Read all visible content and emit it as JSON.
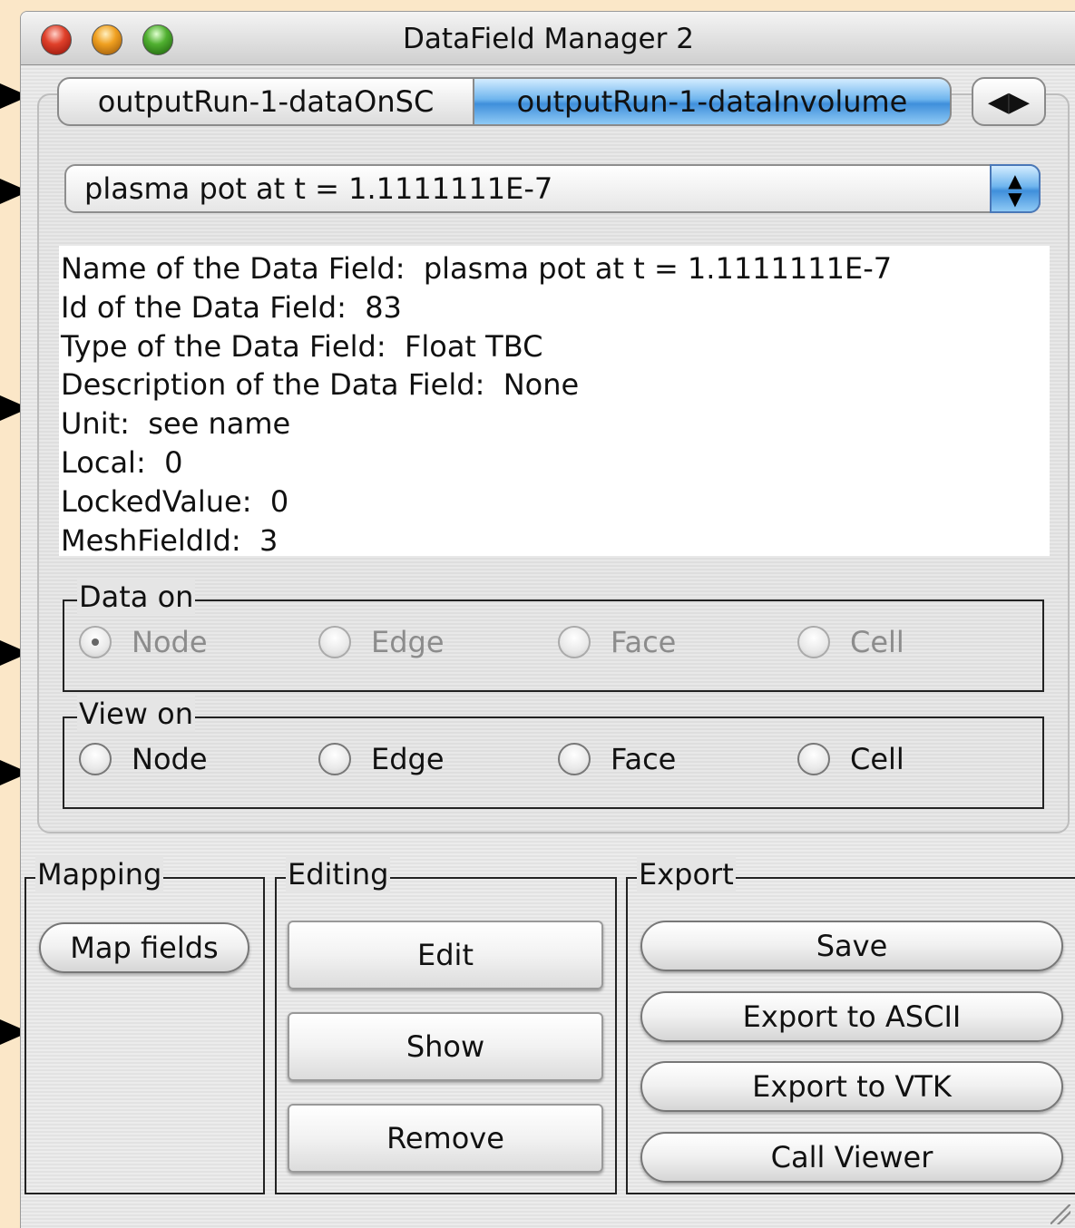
{
  "window": {
    "title": "DataField Manager 2"
  },
  "tabs": [
    {
      "label": "outputRun-1-dataOnSC",
      "selected": false
    },
    {
      "label": "outputRun-1-dataInvolume",
      "selected": true
    }
  ],
  "tab_scroll_icon": "left-right-arrows-icon",
  "field_selector": {
    "selected": "plasma pot at t = 1.1111111E-7"
  },
  "info": {
    "lines": [
      "Name of the Data Field:  plasma pot at t = 1.1111111E-7",
      "Id of the Data Field:  83",
      "Type of the Data Field:  Float TBC",
      "Description of the Data Field:  None",
      "Unit:  see name",
      "Local:  0",
      "LockedValue:  0",
      "MeshFieldId:  3"
    ]
  },
  "data_on": {
    "label": "Data on",
    "options": [
      "Node",
      "Edge",
      "Face",
      "Cell"
    ],
    "selected": "Node",
    "enabled": false
  },
  "view_on": {
    "label": "View on",
    "options": [
      "Node",
      "Edge",
      "Face",
      "Cell"
    ],
    "selected": null,
    "enabled": true
  },
  "mapping": {
    "label": "Mapping",
    "map_fields": "Map fields"
  },
  "editing": {
    "label": "Editing",
    "edit": "Edit",
    "show": "Show",
    "remove": "Remove"
  },
  "export": {
    "label": "Export",
    "save": "Save",
    "export_ascii": "Export to ASCII",
    "export_vtk": "Export to VTK",
    "call_viewer": "Call Viewer"
  },
  "colors": {
    "page_background": "#fbe7c8",
    "selected_tab": "#3f8fdb",
    "window_background": "#e8e8e8"
  }
}
